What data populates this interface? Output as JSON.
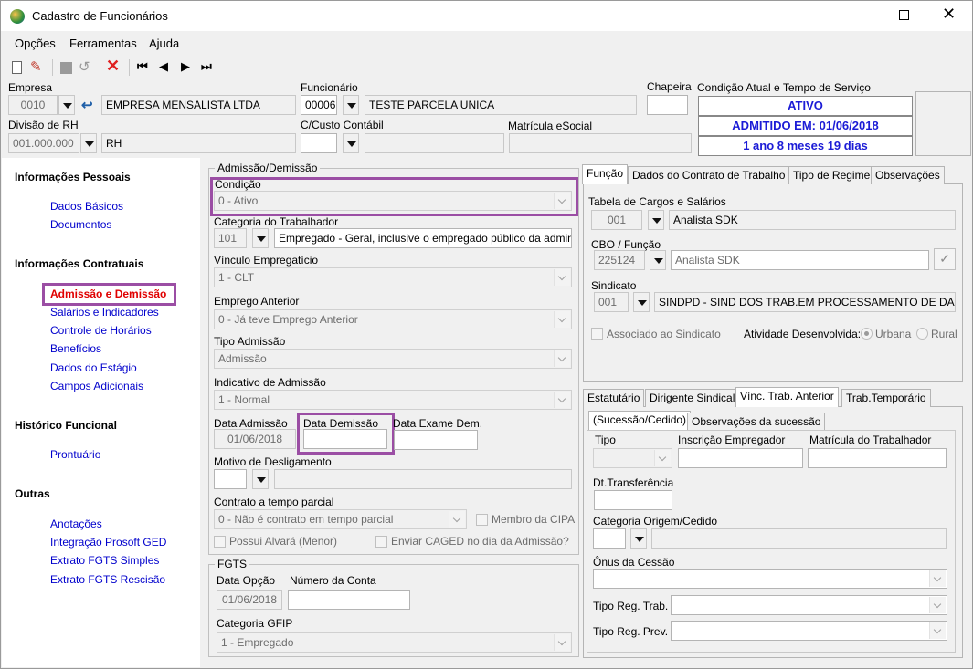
{
  "window": {
    "title": "Cadastro de Funcionários"
  },
  "menu": [
    "Opções",
    "Ferramentas",
    "Ajuda"
  ],
  "header": {
    "empresa_label": "Empresa",
    "empresa_code": "0010",
    "empresa_name": "EMPRESA MENSALISTA LTDA",
    "divisao_label": "Divisão de RH",
    "divisao_code": "001.000.000",
    "divisao_name": "RH",
    "funcionario_label": "Funcionário",
    "funcionario_code": "00006",
    "funcionario_name": "TESTE PARCELA UNICA",
    "ccusto_label": "C/Custo Contábil",
    "matricula_label": "Matrícula eSocial",
    "chapeira_label": "Chapeira",
    "condicao_label": "Condição Atual e Tempo de Serviço",
    "status": "ATIVO",
    "admitido": "ADMITIDO EM: 01/06/2018",
    "tempo": "1 ano 8 meses 19 dias"
  },
  "sidebar": {
    "sections": [
      {
        "title": "Informações Pessoais",
        "items": [
          "Dados Básicos",
          "Documentos"
        ]
      },
      {
        "title": "Informações Contratuais",
        "items": [
          "Admissão e Demissão",
          "Salários e Indicadores",
          "Controle de Horários",
          "Benefícios",
          "Dados do Estágio",
          "Campos Adicionais"
        ]
      },
      {
        "title": "Histórico Funcional",
        "items": [
          "Prontuário"
        ]
      },
      {
        "title": "Outras",
        "items": [
          "Anotações",
          "Integração Prosoft GED",
          "Extrato FGTS Simples",
          "Extrato FGTS Rescisão"
        ]
      }
    ],
    "active": "Admissão e Demissão"
  },
  "admissao": {
    "group_title": "Admissão/Demissão",
    "condicao_label": "Condição",
    "condicao_value": "0 - Ativo",
    "categoria_label": "Categoria do Trabalhador",
    "categoria_code": "101",
    "categoria_desc": "Empregado - Geral, inclusive o empregado público da administ",
    "vinculo_label": "Vínculo Empregatício",
    "vinculo_value": "1 - CLT",
    "emprego_label": "Emprego Anterior",
    "emprego_value": "0 - Já teve Emprego Anterior",
    "tipo_label": "Tipo Admissão",
    "tipo_value": "Admissão",
    "indicativo_label": "Indicativo de Admissão",
    "indicativo_value": "1 - Normal",
    "data_admissao_label": "Data Admissão",
    "data_admissao": "01/06/2018",
    "data_demissao_label": "Data Demissão",
    "data_demissao": "",
    "data_exame_label": "Data Exame Dem.",
    "motivo_label": "Motivo de Desligamento",
    "contrato_label": "Contrato a tempo parcial",
    "contrato_value": "0 - Não é contrato em tempo parcial",
    "cipa_label": "Membro da CIPA",
    "alvara_label": "Possui Alvará (Menor)",
    "caged_label": "Enviar CAGED no dia da Admissão?"
  },
  "fgts": {
    "group_title": "FGTS",
    "data_opcao_label": "Data Opção",
    "data_opcao": "01/06/2018",
    "conta_label": "Número da Conta",
    "gfip_label": "Categoria GFIP",
    "gfip_value": "1 - Empregado"
  },
  "right_top": {
    "tabs": [
      "Função",
      "Dados do Contrato de Trabalho",
      "Tipo de Regime",
      "Observações"
    ],
    "tabela_label": "Tabela de Cargos e Salários",
    "tabela_code": "001",
    "tabela_name": "Analista SDK",
    "cbo_label": "CBO / Função",
    "cbo_code": "225124",
    "cbo_name": "Analista SDK",
    "sindicato_label": "Sindicato",
    "sindicato_code": "001",
    "sindicato_name": "SINDPD - SIND DOS TRAB.EM PROCESSAMENTO DE DADOS ES",
    "associado_label": "Associado ao Sindicato",
    "atividade_label": "Atividade Desenvolvida:",
    "urbana": "Urbana",
    "rural": "Rural"
  },
  "right_bottom": {
    "tabs": [
      "Estatutário",
      "Dirigente Sindical",
      "Vínc. Trab. Anterior",
      "Trab.Temporário"
    ],
    "subtabs": [
      "(Sucessão/Cedido)",
      "Observações da sucessão"
    ],
    "tipo_label": "Tipo",
    "inscricao_label": "Inscrição Empregador",
    "matricula_label": "Matrícula do Trabalhador",
    "dt_label": "Dt.Transferência",
    "categoria_label": "Categoria Origem/Cedido",
    "onus_label": "Ônus da Cessão",
    "tipo_trab_label": "Tipo Reg. Trab.",
    "tipo_prev_label": "Tipo Reg. Prev."
  },
  "colors": {
    "highlight": "#9b4ea4",
    "link": "#0000cc",
    "active_link": "#e00000",
    "status_text": "#1b1bd6"
  }
}
